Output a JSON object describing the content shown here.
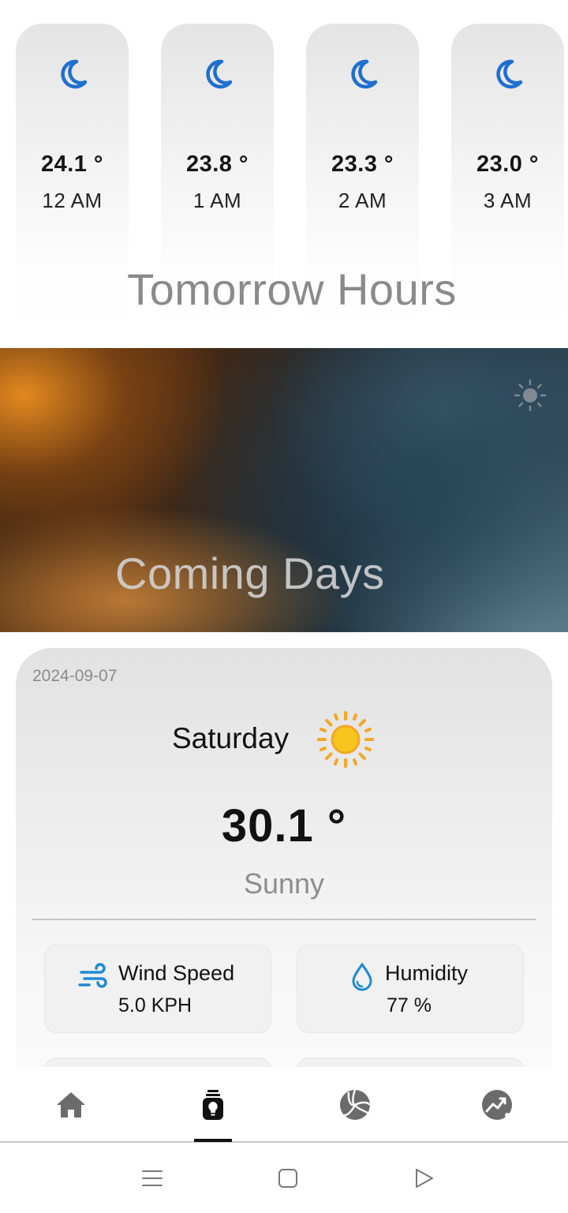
{
  "hourly": {
    "section_title": "Tomorrow Hours",
    "items": [
      {
        "temp": "24.1 °",
        "time": "12  AM",
        "icon": "moon-icon"
      },
      {
        "temp": "23.8 °",
        "time": "1 AM",
        "icon": "moon-icon"
      },
      {
        "temp": "23.3 °",
        "time": "2 AM",
        "icon": "moon-icon"
      },
      {
        "temp": "23.0 °",
        "time": "3 AM",
        "icon": "moon-icon"
      }
    ]
  },
  "banner": {
    "section_title": "Coming Days",
    "icon": "sun-icon"
  },
  "day": {
    "date": "2024-09-07",
    "name": "Saturday",
    "temp": "30.1 °",
    "condition": "Sunny",
    "icon": "sun-icon",
    "stats": [
      {
        "label": "Wind Speed",
        "value": "5.0 KPH",
        "icon": "wind-icon"
      },
      {
        "label": "Humidity",
        "value": "77 %",
        "icon": "droplet-icon"
      }
    ]
  },
  "bottom_nav": {
    "items": [
      {
        "name": "home",
        "icon": "home-icon",
        "active": false
      },
      {
        "name": "forecast",
        "icon": "lantern-icon",
        "active": true
      },
      {
        "name": "sports",
        "icon": "volleyball-icon",
        "active": false
      },
      {
        "name": "trends",
        "icon": "trend-chart-icon",
        "active": false
      }
    ]
  },
  "colors": {
    "accent_blue": "#1e6fd0",
    "sun_yellow": "#f7c51e",
    "sun_orange": "#f5a623",
    "muted_text": "#8b8b8b",
    "nav_icon": "#6b6b6b"
  }
}
